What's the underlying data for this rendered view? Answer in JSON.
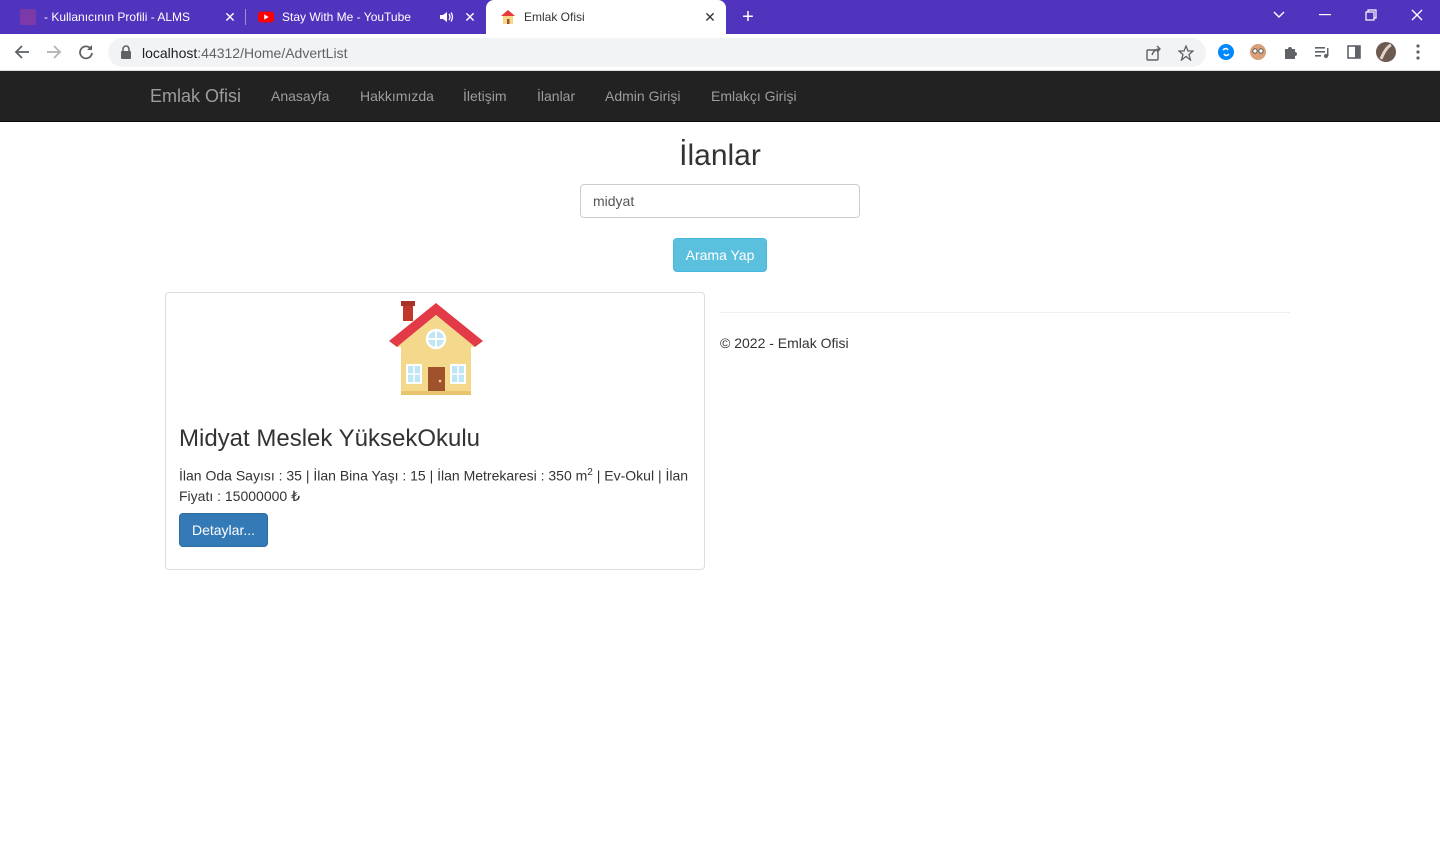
{
  "browser": {
    "tabs": [
      {
        "title": "- Kullanıcının Profili - ALMS",
        "icon": "alms-favicon",
        "active": false
      },
      {
        "title": "Stay With Me - YouTube",
        "icon": "youtube-favicon",
        "active": false,
        "audio": true
      },
      {
        "title": "Emlak Ofisi",
        "icon": "house-favicon",
        "active": true
      }
    ],
    "new_tab_label": "+",
    "url_host": "localhost",
    "url_rest": ":44312/Home/AdvertList"
  },
  "navbar": {
    "brand": "Emlak Ofisi",
    "links": [
      "Anasayfa",
      "Hakkımızda",
      "İletişim",
      "İlanlar",
      "Admin Girişi",
      "Emlakçı Girişi"
    ]
  },
  "page": {
    "title": "İlanlar",
    "search_value": "midyat",
    "search_button": "Arama Yap"
  },
  "listing": {
    "title": "Midyat Meslek YüksekOkulu",
    "desc_before_sup": "İlan Oda Sayısı : 35 | İlan Bina Yaşı : 15 | İlan Metrekaresi : 350 m",
    "desc_sup": "2",
    "desc_after_sup": " | Ev-Okul | İlan Fiyatı : 15000000 ₺",
    "details_button": "Detaylar..."
  },
  "footer": {
    "text": "© 2022 - Emlak Ofisi"
  },
  "colors": {
    "tabbar": "#5034bd",
    "navbar": "#222222",
    "info_button": "#5bc0de",
    "primary_button": "#337ab7"
  }
}
